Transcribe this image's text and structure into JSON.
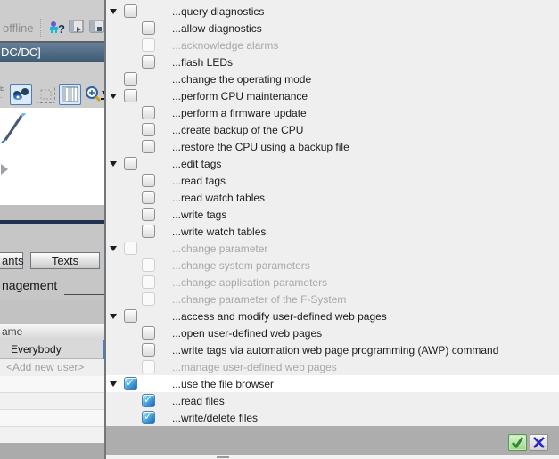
{
  "left_panel": {
    "toolbar": {
      "offline_label": "offline",
      "icons": [
        "user-question-icon",
        "window-start-icon",
        "window-stop-icon"
      ]
    },
    "title_bar": {
      "text": "DC/DC]"
    },
    "view_toolbar": {
      "icons": [
        "glasses-icon",
        "dashed-grid-icon",
        "column-view-icon",
        "zoom-plus-icon",
        "download-arrow-icon"
      ]
    },
    "tabs": [
      {
        "label": "ants"
      },
      {
        "label": "Texts"
      }
    ],
    "section_title": "nagement",
    "user_table": {
      "header": "ame",
      "rows": [
        {
          "name": "Everybody",
          "selected": true
        },
        {
          "name": "<Add new user>",
          "placeholder": true
        }
      ],
      "empty_row_count": 4
    }
  },
  "permissions_panel": {
    "items": [
      {
        "label": "...query diagnostics",
        "level": 1,
        "expand": true,
        "checked": false,
        "disabled": false,
        "selected": false
      },
      {
        "label": "...allow diagnostics",
        "level": 2,
        "expand": false,
        "checked": false,
        "disabled": false,
        "selected": false
      },
      {
        "label": "...acknowledge alarms",
        "level": 2,
        "expand": false,
        "checked": false,
        "disabled": true,
        "selected": false
      },
      {
        "label": "...flash LEDs",
        "level": 2,
        "expand": false,
        "checked": false,
        "disabled": false,
        "selected": false
      },
      {
        "label": "...change the operating mode",
        "level": 1,
        "expand": false,
        "checked": false,
        "disabled": false,
        "selected": false
      },
      {
        "label": "...perform CPU maintenance",
        "level": 1,
        "expand": true,
        "checked": false,
        "disabled": false,
        "selected": false
      },
      {
        "label": "...perform a firmware update",
        "level": 2,
        "expand": false,
        "checked": false,
        "disabled": false,
        "selected": false
      },
      {
        "label": "...create backup of the CPU",
        "level": 2,
        "expand": false,
        "checked": false,
        "disabled": false,
        "selected": false
      },
      {
        "label": "...restore the CPU using a backup file",
        "level": 2,
        "expand": false,
        "checked": false,
        "disabled": false,
        "selected": false
      },
      {
        "label": "...edit tags",
        "level": 1,
        "expand": true,
        "checked": false,
        "disabled": false,
        "selected": false
      },
      {
        "label": "...read tags",
        "level": 2,
        "expand": false,
        "checked": false,
        "disabled": false,
        "selected": false
      },
      {
        "label": "...read watch tables",
        "level": 2,
        "expand": false,
        "checked": false,
        "disabled": false,
        "selected": false
      },
      {
        "label": "...write tags",
        "level": 2,
        "expand": false,
        "checked": false,
        "disabled": false,
        "selected": false
      },
      {
        "label": "...write watch tables",
        "level": 2,
        "expand": false,
        "checked": false,
        "disabled": false,
        "selected": false
      },
      {
        "label": "...change parameter",
        "level": 1,
        "expand": true,
        "checked": false,
        "disabled": true,
        "selected": false
      },
      {
        "label": "...change system parameters",
        "level": 2,
        "expand": false,
        "checked": false,
        "disabled": true,
        "selected": false
      },
      {
        "label": "...change application parameters",
        "level": 2,
        "expand": false,
        "checked": false,
        "disabled": true,
        "selected": false
      },
      {
        "label": "...change parameter of the F-System",
        "level": 2,
        "expand": false,
        "checked": false,
        "disabled": true,
        "selected": false
      },
      {
        "label": "...access and modify user-defined web pages",
        "level": 1,
        "expand": true,
        "checked": false,
        "disabled": false,
        "selected": false
      },
      {
        "label": "...open user-defined web pages",
        "level": 2,
        "expand": false,
        "checked": false,
        "disabled": false,
        "selected": false
      },
      {
        "label": "...write tags via automation web page programming (AWP) command",
        "level": 2,
        "expand": false,
        "checked": false,
        "disabled": false,
        "selected": false
      },
      {
        "label": "...manage user-defined web pages",
        "level": 2,
        "expand": false,
        "checked": false,
        "disabled": true,
        "selected": false
      },
      {
        "label": "...use the file browser",
        "level": 1,
        "expand": true,
        "checked": true,
        "disabled": false,
        "selected": true
      },
      {
        "label": "...read files",
        "level": 2,
        "expand": false,
        "checked": true,
        "disabled": false,
        "selected": false
      },
      {
        "label": "...write/delete files",
        "level": 2,
        "expand": false,
        "checked": true,
        "disabled": false,
        "selected": false
      }
    ],
    "footer": {
      "ok_icon": "green-checkmark",
      "cancel_icon": "blue-x"
    }
  },
  "glyphs": {
    "check": "✓"
  },
  "colors": {
    "checked_blue": "#1565b8",
    "ok_green": "#2c8c2c",
    "cancel_x_blue": "#2424c8",
    "titlebar": "#4a6379",
    "footer_grey": "#adadad"
  }
}
